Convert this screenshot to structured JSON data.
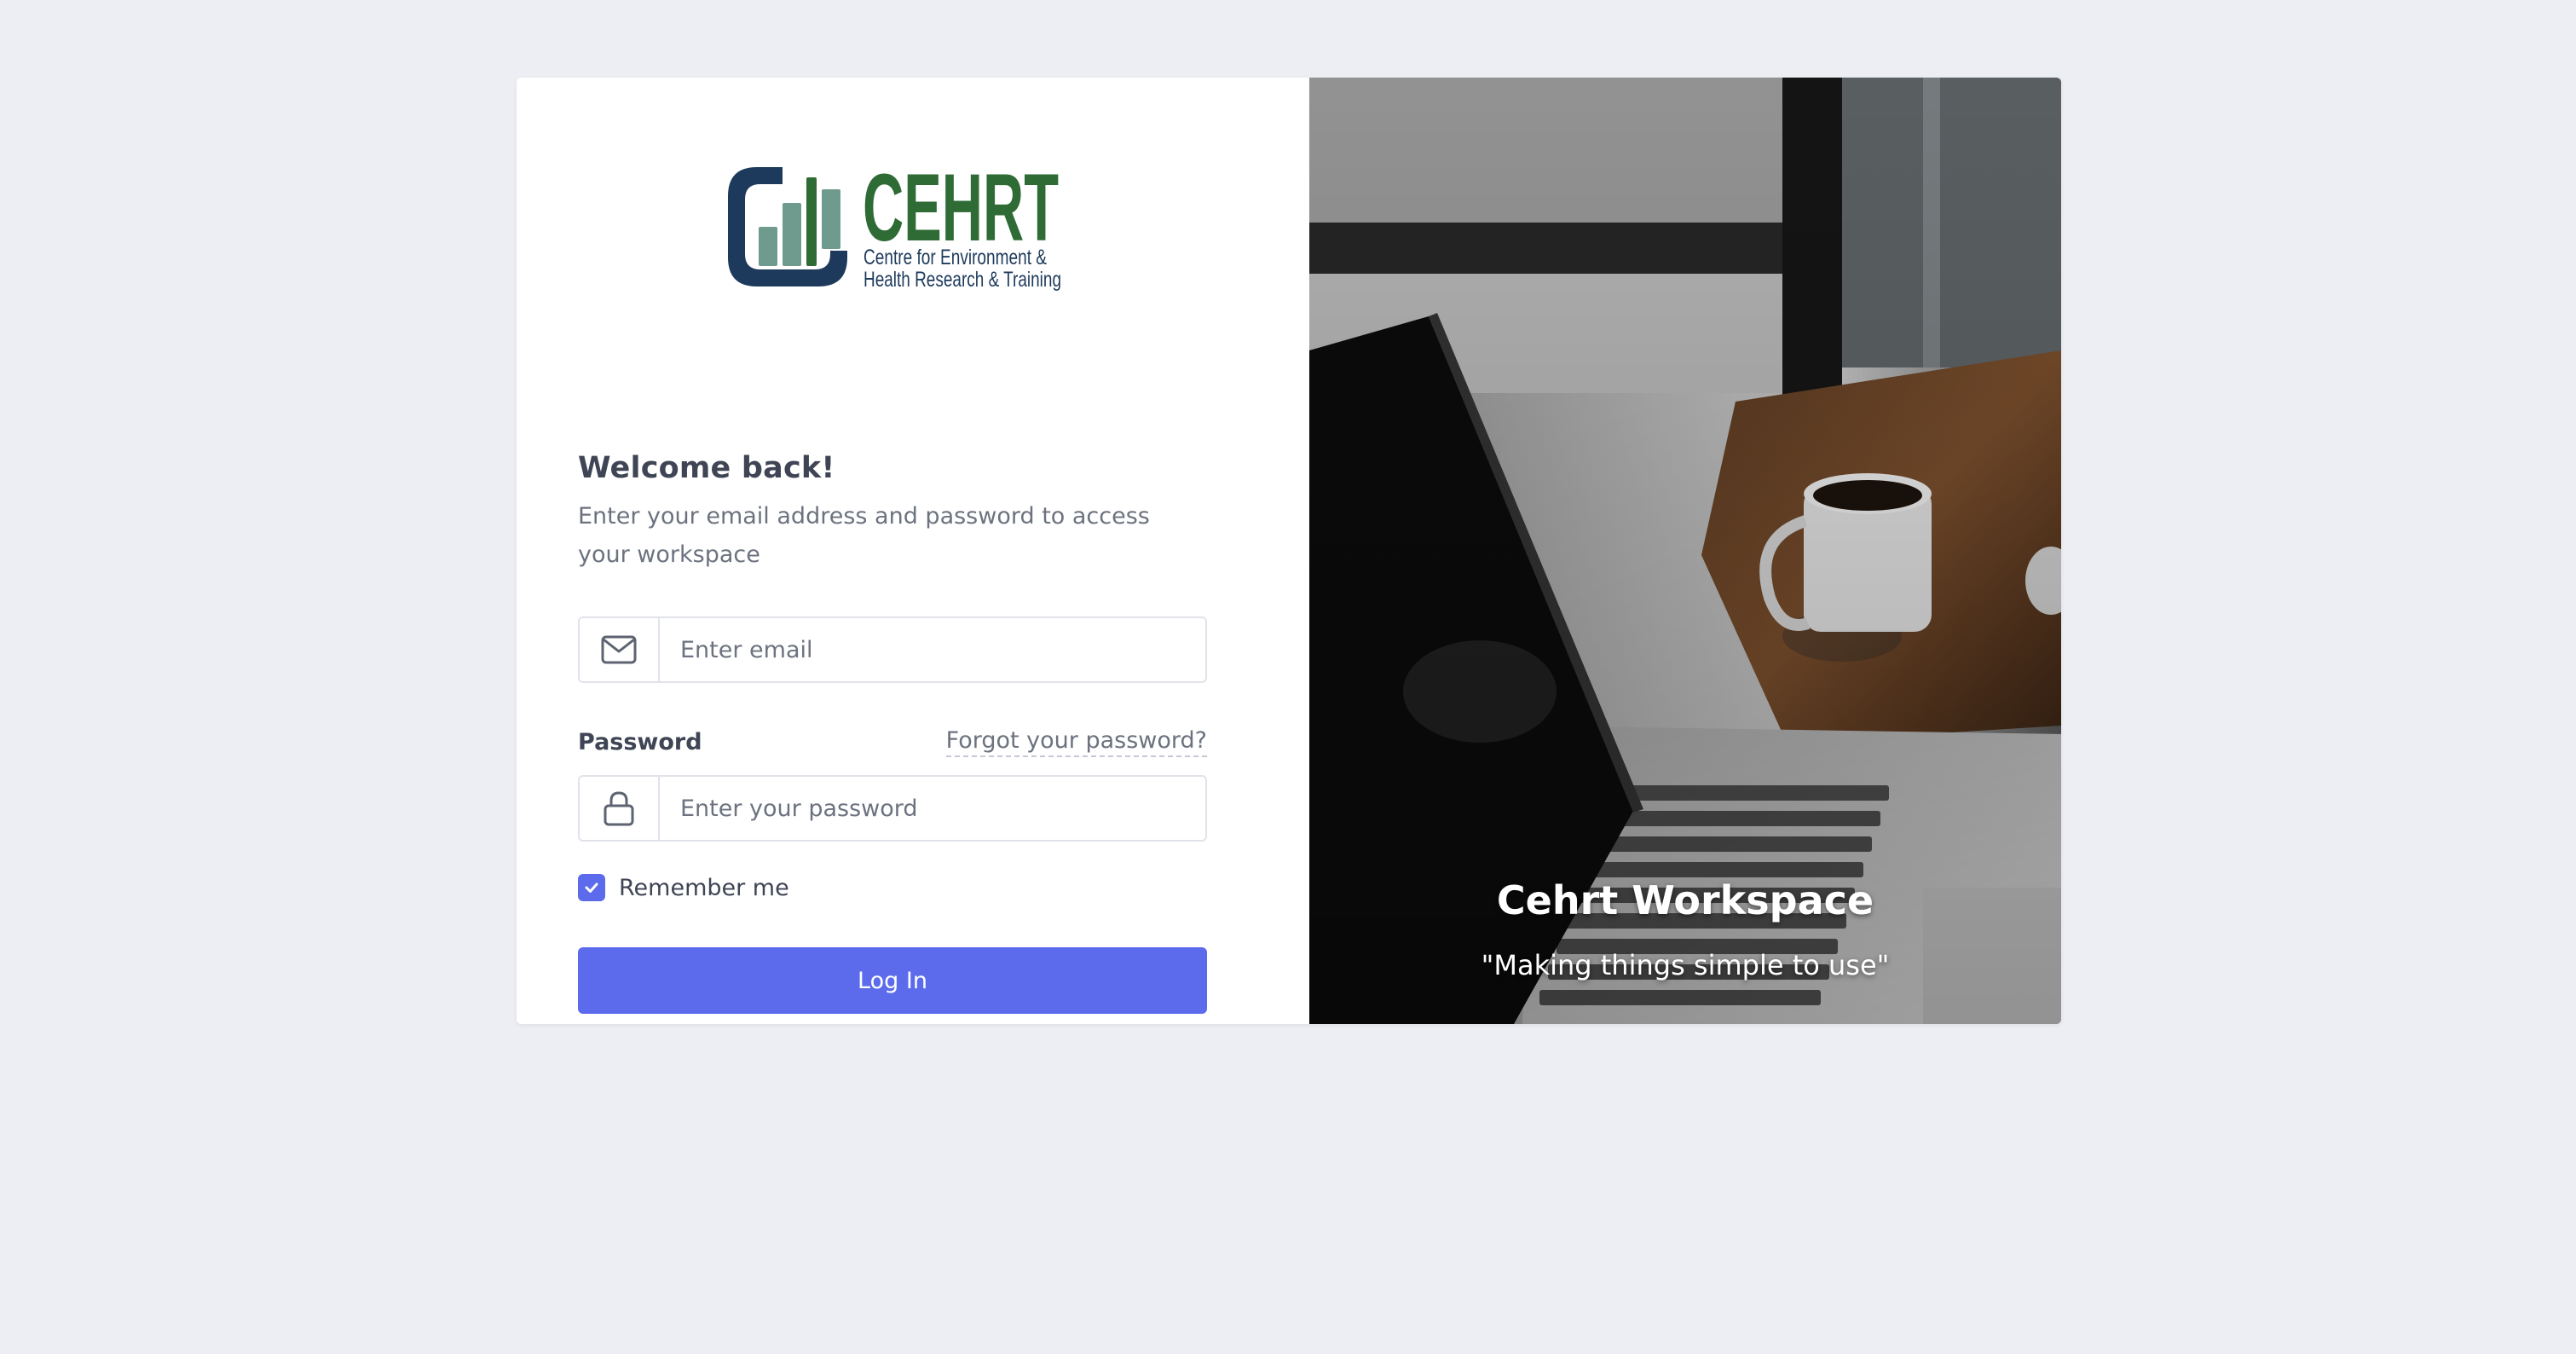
{
  "logo": {
    "name": "CEHRT",
    "tagline_line1": "Centre for Environment &",
    "tagline_line2": "Health Research & Training",
    "colors": {
      "dark": "#1d3a5c",
      "green": "#2e6b35",
      "light": "#6f9b8e"
    }
  },
  "login": {
    "heading": "Welcome back!",
    "subtitle": "Enter your email address and password to access your workspace",
    "email": {
      "placeholder": "Enter email",
      "value": "",
      "icon": "envelope-icon"
    },
    "password": {
      "label": "Password",
      "placeholder": "Enter your password",
      "value": "",
      "icon": "lock-icon",
      "forgot_label": "Forgot your password?"
    },
    "remember": {
      "label": "Remember me",
      "checked": true
    },
    "submit_label": "Log In"
  },
  "hero": {
    "title": "Cehrt Workspace",
    "quote": "\"Making things simple to use\""
  },
  "colors": {
    "background": "#edeef3",
    "primary": "#5b6bec",
    "text_dark": "#3f4555",
    "text_muted": "#6c727f"
  }
}
